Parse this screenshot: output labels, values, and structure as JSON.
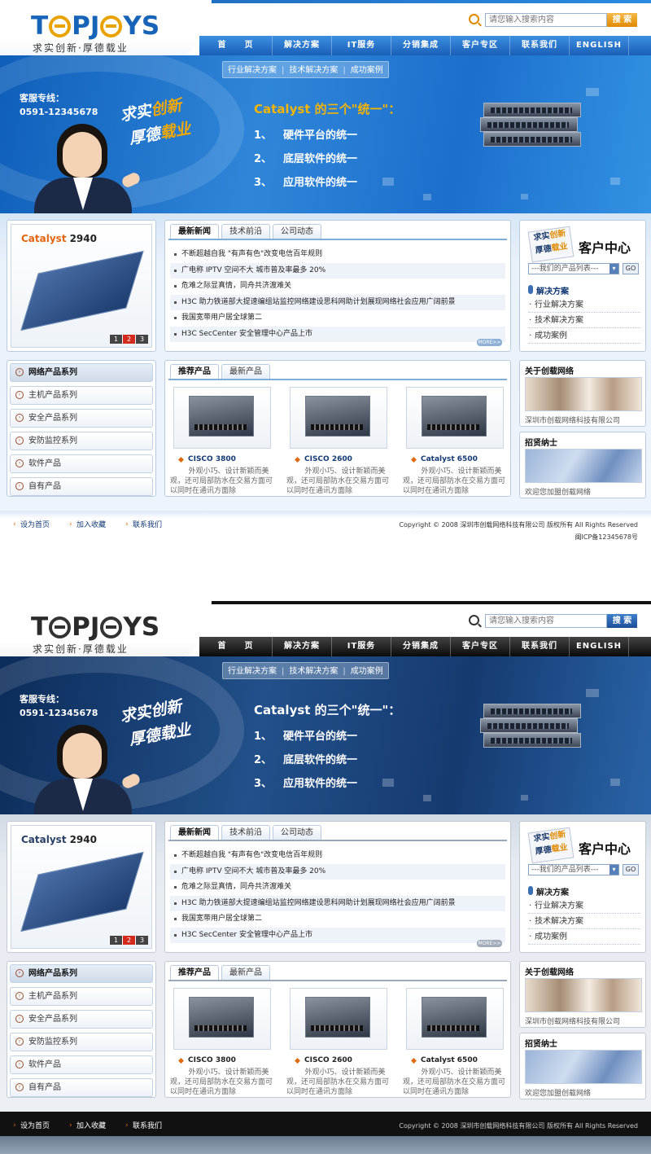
{
  "brand": {
    "logo_text_a": "T",
    "logo_text_b": "PJ",
    "logo_text_c": "YS",
    "slogan": "求实创新·厚德载业"
  },
  "search": {
    "placeholder": "请您输入搜索内容",
    "button": "搜 索"
  },
  "nav": {
    "items": [
      "首　　页",
      "解决方案",
      "IT服务",
      "分销集成",
      "客户专区",
      "联系我们",
      "ENGLISH"
    ]
  },
  "subnav": {
    "items": [
      "行业解决方案",
      "技术解决方案",
      "成功案例"
    ],
    "separator": "|"
  },
  "banner": {
    "hotline_label": "客服专线：",
    "hotline_number": "0591-12345678",
    "slogan_line1_a": "求实",
    "slogan_line1_b": "创新",
    "slogan_line2_a": "厚德",
    "slogan_line2_b": "载业",
    "title": "Catalyst 的三个\"统一\"：",
    "points": [
      {
        "num": "1、",
        "text": "硬件平台的统一"
      },
      {
        "num": "2、",
        "text": "底层软件的统一"
      },
      {
        "num": "3、",
        "text": "应用软件的统一"
      }
    ]
  },
  "product_showcase": {
    "name": "Catalyst",
    "model": "2940",
    "pages": [
      "1",
      "2",
      "3"
    ],
    "active_page": "2"
  },
  "news": {
    "tabs": [
      "最新新闻",
      "技术前沿",
      "公司动态"
    ],
    "items": [
      "不断超越自我 \"有声有色\"改变电信百年规则",
      "广电称 IPTV 空间不大 城市普及率最多 20%",
      "危难之际显真情，同舟共济渡难关",
      "H3C 助力铁道部大提速编组站监控网络建设思科网助计划展现网络社会应用广阔前景",
      "我国宽带用户居全球第二",
      "H3C SecCenter 安全管理中心产品上市"
    ],
    "more": "MORE>>"
  },
  "client_center": {
    "stamp_line1_a": "求实",
    "stamp_line1_b": "创新",
    "stamp_line2_a": "厚德",
    "stamp_line2_b": "载业",
    "title": "客户中心",
    "select_value": "---我们的产品列表---",
    "go": "GO",
    "solutions_title": "解决方案",
    "solutions": [
      "行业解决方案",
      "技术解决方案",
      "成功案例"
    ]
  },
  "categories": {
    "items": [
      "网络产品系列",
      "主机产品系列",
      "安全产品系列",
      "安防监控系列",
      "软件产品",
      "自有产品"
    ]
  },
  "recommended": {
    "tabs": [
      "推荐产品",
      "最新产品"
    ],
    "products": [
      {
        "name": "CISCO 3800",
        "desc": "外观小巧、设计新颖而美观，还可局部防水在交易方面可以同时在通讯方面除"
      },
      {
        "name": "CISCO 2600",
        "desc": "外观小巧、设计新颖而美观，还可局部防水在交易方面可以同时在通讯方面除"
      },
      {
        "name": "Catalyst 6500",
        "desc": "外观小巧、设计新颖而美观，还可局部防水在交易方面可以同时在通讯方面除"
      }
    ]
  },
  "about": {
    "title": "关于创载网络",
    "caption": "深圳市创载网络科技有限公司"
  },
  "hire": {
    "title": "招贤纳士",
    "caption": "欢迎您加盟创载网络"
  },
  "footer": {
    "links": [
      "设为首页",
      "加入收藏",
      "联系我们"
    ],
    "copyright": "Copyright © 2008 深圳市创载网络科技有限公司 版权所有 All Rights Reserved",
    "icp": "闽ICP备12345678号"
  },
  "colors": {
    "theme1_primary": "#1a5fb8",
    "theme1_accent": "#e28a00",
    "theme2_primary": "#111111",
    "theme2_accent": "#1e4f98"
  }
}
